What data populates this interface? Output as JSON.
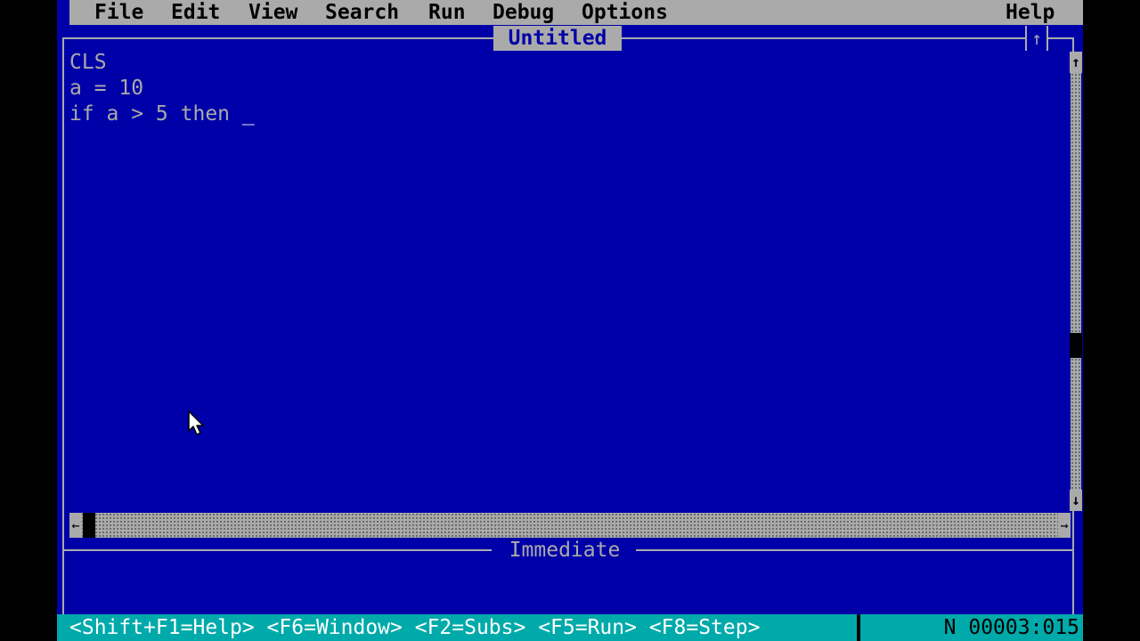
{
  "menu": {
    "file": "File",
    "edit": "Edit",
    "view": "View",
    "search": "Search",
    "run": "Run",
    "debug": "Debug",
    "options": "Options",
    "help": "Help"
  },
  "editor": {
    "title": "Untitled",
    "maximize_glyph": "↑",
    "lines": [
      "CLS",
      "a = 10",
      "if a > 5 then "
    ],
    "caret": "_"
  },
  "scrollbars": {
    "up_arrow": "↑",
    "down_arrow": "↓",
    "left_arrow": "←",
    "right_arrow": "→"
  },
  "immediate": {
    "title": "Immediate"
  },
  "status": {
    "keys": "<Shift+F1=Help> <F6=Window> <F2=Subs> <F5=Run> <F8=Step>",
    "position": "N 00003:015"
  },
  "colors": {
    "background": "#0000a8",
    "menu_bar": "#aaaaaa",
    "text": "#aaaaaa",
    "status_bar": "#00aaaa"
  }
}
